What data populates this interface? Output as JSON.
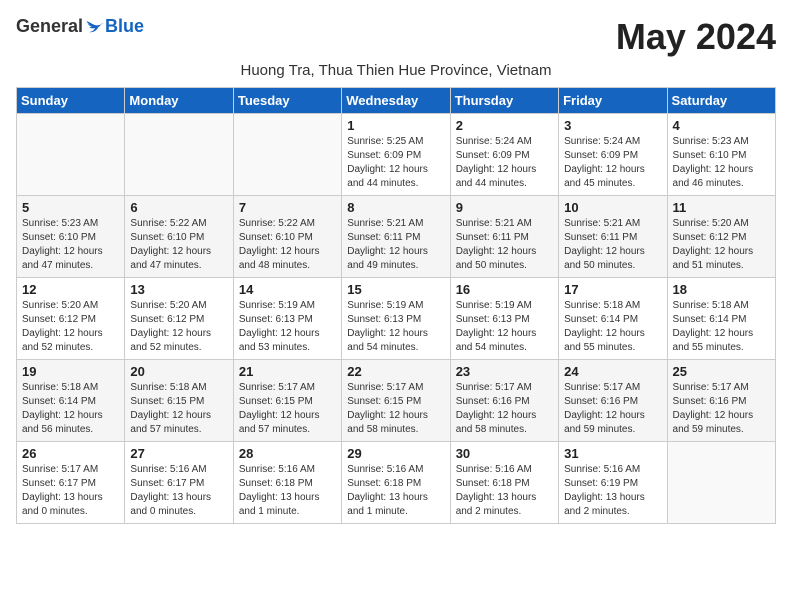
{
  "header": {
    "logo_general": "General",
    "logo_blue": "Blue",
    "month_title": "May 2024",
    "location": "Huong Tra, Thua Thien Hue Province, Vietnam"
  },
  "calendar": {
    "days_of_week": [
      "Sunday",
      "Monday",
      "Tuesday",
      "Wednesday",
      "Thursday",
      "Friday",
      "Saturday"
    ],
    "weeks": [
      [
        {
          "day": "",
          "info": ""
        },
        {
          "day": "",
          "info": ""
        },
        {
          "day": "",
          "info": ""
        },
        {
          "day": "1",
          "info": "Sunrise: 5:25 AM\nSunset: 6:09 PM\nDaylight: 12 hours\nand 44 minutes."
        },
        {
          "day": "2",
          "info": "Sunrise: 5:24 AM\nSunset: 6:09 PM\nDaylight: 12 hours\nand 44 minutes."
        },
        {
          "day": "3",
          "info": "Sunrise: 5:24 AM\nSunset: 6:09 PM\nDaylight: 12 hours\nand 45 minutes."
        },
        {
          "day": "4",
          "info": "Sunrise: 5:23 AM\nSunset: 6:10 PM\nDaylight: 12 hours\nand 46 minutes."
        }
      ],
      [
        {
          "day": "5",
          "info": "Sunrise: 5:23 AM\nSunset: 6:10 PM\nDaylight: 12 hours\nand 47 minutes."
        },
        {
          "day": "6",
          "info": "Sunrise: 5:22 AM\nSunset: 6:10 PM\nDaylight: 12 hours\nand 47 minutes."
        },
        {
          "day": "7",
          "info": "Sunrise: 5:22 AM\nSunset: 6:10 PM\nDaylight: 12 hours\nand 48 minutes."
        },
        {
          "day": "8",
          "info": "Sunrise: 5:21 AM\nSunset: 6:11 PM\nDaylight: 12 hours\nand 49 minutes."
        },
        {
          "day": "9",
          "info": "Sunrise: 5:21 AM\nSunset: 6:11 PM\nDaylight: 12 hours\nand 50 minutes."
        },
        {
          "day": "10",
          "info": "Sunrise: 5:21 AM\nSunset: 6:11 PM\nDaylight: 12 hours\nand 50 minutes."
        },
        {
          "day": "11",
          "info": "Sunrise: 5:20 AM\nSunset: 6:12 PM\nDaylight: 12 hours\nand 51 minutes."
        }
      ],
      [
        {
          "day": "12",
          "info": "Sunrise: 5:20 AM\nSunset: 6:12 PM\nDaylight: 12 hours\nand 52 minutes."
        },
        {
          "day": "13",
          "info": "Sunrise: 5:20 AM\nSunset: 6:12 PM\nDaylight: 12 hours\nand 52 minutes."
        },
        {
          "day": "14",
          "info": "Sunrise: 5:19 AM\nSunset: 6:13 PM\nDaylight: 12 hours\nand 53 minutes."
        },
        {
          "day": "15",
          "info": "Sunrise: 5:19 AM\nSunset: 6:13 PM\nDaylight: 12 hours\nand 54 minutes."
        },
        {
          "day": "16",
          "info": "Sunrise: 5:19 AM\nSunset: 6:13 PM\nDaylight: 12 hours\nand 54 minutes."
        },
        {
          "day": "17",
          "info": "Sunrise: 5:18 AM\nSunset: 6:14 PM\nDaylight: 12 hours\nand 55 minutes."
        },
        {
          "day": "18",
          "info": "Sunrise: 5:18 AM\nSunset: 6:14 PM\nDaylight: 12 hours\nand 55 minutes."
        }
      ],
      [
        {
          "day": "19",
          "info": "Sunrise: 5:18 AM\nSunset: 6:14 PM\nDaylight: 12 hours\nand 56 minutes."
        },
        {
          "day": "20",
          "info": "Sunrise: 5:18 AM\nSunset: 6:15 PM\nDaylight: 12 hours\nand 57 minutes."
        },
        {
          "day": "21",
          "info": "Sunrise: 5:17 AM\nSunset: 6:15 PM\nDaylight: 12 hours\nand 57 minutes."
        },
        {
          "day": "22",
          "info": "Sunrise: 5:17 AM\nSunset: 6:15 PM\nDaylight: 12 hours\nand 58 minutes."
        },
        {
          "day": "23",
          "info": "Sunrise: 5:17 AM\nSunset: 6:16 PM\nDaylight: 12 hours\nand 58 minutes."
        },
        {
          "day": "24",
          "info": "Sunrise: 5:17 AM\nSunset: 6:16 PM\nDaylight: 12 hours\nand 59 minutes."
        },
        {
          "day": "25",
          "info": "Sunrise: 5:17 AM\nSunset: 6:16 PM\nDaylight: 12 hours\nand 59 minutes."
        }
      ],
      [
        {
          "day": "26",
          "info": "Sunrise: 5:17 AM\nSunset: 6:17 PM\nDaylight: 13 hours\nand 0 minutes."
        },
        {
          "day": "27",
          "info": "Sunrise: 5:16 AM\nSunset: 6:17 PM\nDaylight: 13 hours\nand 0 minutes."
        },
        {
          "day": "28",
          "info": "Sunrise: 5:16 AM\nSunset: 6:18 PM\nDaylight: 13 hours\nand 1 minute."
        },
        {
          "day": "29",
          "info": "Sunrise: 5:16 AM\nSunset: 6:18 PM\nDaylight: 13 hours\nand 1 minute."
        },
        {
          "day": "30",
          "info": "Sunrise: 5:16 AM\nSunset: 6:18 PM\nDaylight: 13 hours\nand 2 minutes."
        },
        {
          "day": "31",
          "info": "Sunrise: 5:16 AM\nSunset: 6:19 PM\nDaylight: 13 hours\nand 2 minutes."
        },
        {
          "day": "",
          "info": ""
        }
      ]
    ]
  }
}
